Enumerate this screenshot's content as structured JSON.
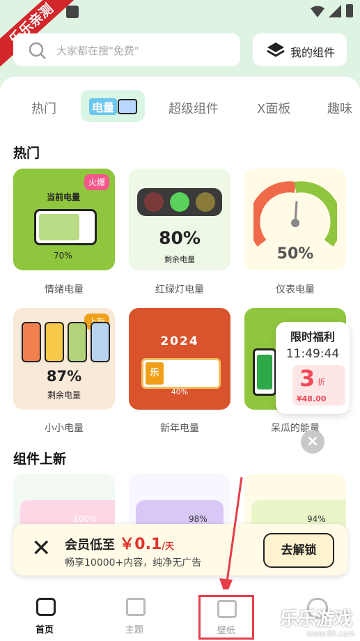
{
  "ribbon": "乐乐亲测",
  "search": {
    "placeholder": "大家都在搜\"免费\""
  },
  "my_widgets": "我的组件",
  "tabs": [
    "热门",
    "电量",
    "超级组件",
    "X面板",
    "趣味"
  ],
  "hot": {
    "title": "热门",
    "cards": [
      {
        "label": "情绪电量",
        "badge": "火爆",
        "inner_title": "当前电量",
        "inner_value": "70%"
      },
      {
        "label": "红绿灯电量",
        "inner_value": "80%",
        "inner_sub": "剩余电量"
      },
      {
        "label": "仪表电量",
        "inner_value": "50%"
      },
      {
        "label": "小小电量",
        "badge": "上新",
        "inner_value": "87%",
        "inner_sub": "剩余电量"
      },
      {
        "label": "新年电量",
        "inner_year": "2024",
        "inner_icon": "乐",
        "inner_value": "40%"
      },
      {
        "label": "呆瓜的能量"
      }
    ]
  },
  "new_widgets": {
    "title": "组件上新",
    "values": [
      "100%",
      "98%",
      "94%"
    ]
  },
  "limited_popup": {
    "title": "限时福利",
    "time": "11:49:44",
    "discount": "3",
    "discount_unit": "折",
    "price": "¥48.00"
  },
  "promo": {
    "title_prefix": "会员低至",
    "price": "￥0.1",
    "unit": "/天",
    "subtitle": "畅享10000+内容，纯净无广告",
    "button": "去解锁"
  },
  "nav": [
    {
      "label": "首页"
    },
    {
      "label": "主题"
    },
    {
      "label": "壁纸"
    },
    {
      "label": "我的"
    }
  ],
  "watermark": "乐乐游戏",
  "watermark_url": "www.6ll.com",
  "colors": {
    "accent_green": "#8fc63d",
    "highlight": "#e53e4a",
    "price_red": "#e0342b"
  }
}
